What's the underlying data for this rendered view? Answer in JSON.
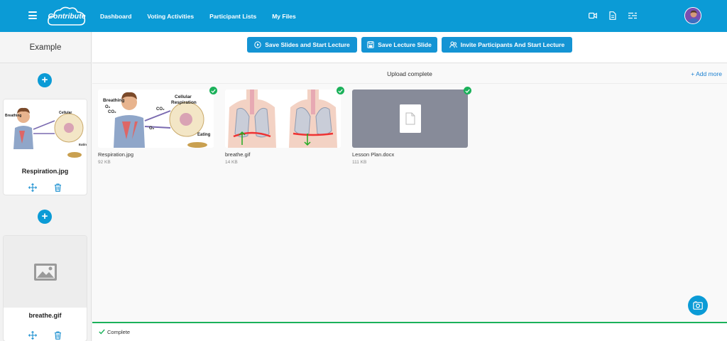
{
  "nav": {
    "logo_text": "Contribute",
    "links": [
      "Dashboard",
      "Voting Activities",
      "Participant Lists",
      "My Files"
    ],
    "icons": [
      "video-icon",
      "file-icon",
      "filter-list-icon"
    ]
  },
  "sidebar": {
    "title": "Example",
    "slides": [
      {
        "name": "Respiration.jpg"
      },
      {
        "name": "breathe.gif"
      }
    ]
  },
  "toolbar": {
    "buttons": [
      {
        "label": "Save Slides and Start Lecture",
        "icon": "play-circle-icon"
      },
      {
        "label": "Save Lecture Slide",
        "icon": "save-icon"
      },
      {
        "label": "Invite Participants And Start Lecture",
        "icon": "people-icon"
      }
    ]
  },
  "upload": {
    "status": "Upload complete",
    "add_more": "+ Add more",
    "files": [
      {
        "name": "Respiration.jpg",
        "size": "92 KB"
      },
      {
        "name": "breathe.gif",
        "size": "14 KB"
      },
      {
        "name": "Lesson Plan.docx",
        "size": "111 KB"
      }
    ]
  },
  "footer": {
    "status": "Complete"
  },
  "colors": {
    "brand": "#0b9bd6",
    "button": "#1494d4",
    "success": "#1bb15a"
  }
}
